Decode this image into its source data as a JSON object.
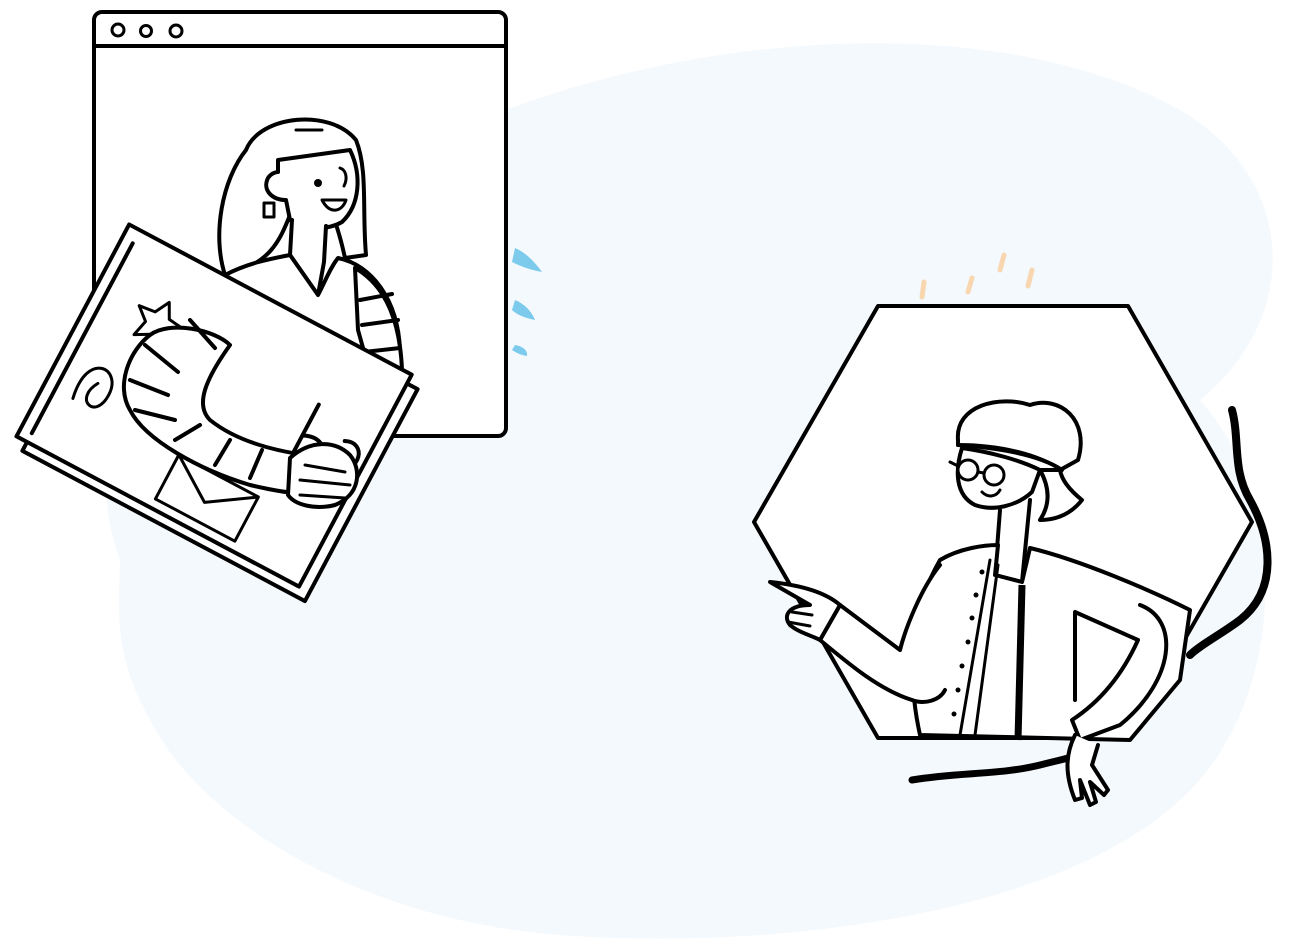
{
  "illustration": {
    "background_color": "#f4f9fd",
    "accent_blue": "#7ccbec",
    "accent_peach": "#f8d7b0",
    "ink_color": "#000000",
    "window_controls": [
      "circle",
      "circle",
      "circle"
    ],
    "left_figure": "person-holding-document",
    "right_figure": "person-pointing-in-hexagon"
  }
}
